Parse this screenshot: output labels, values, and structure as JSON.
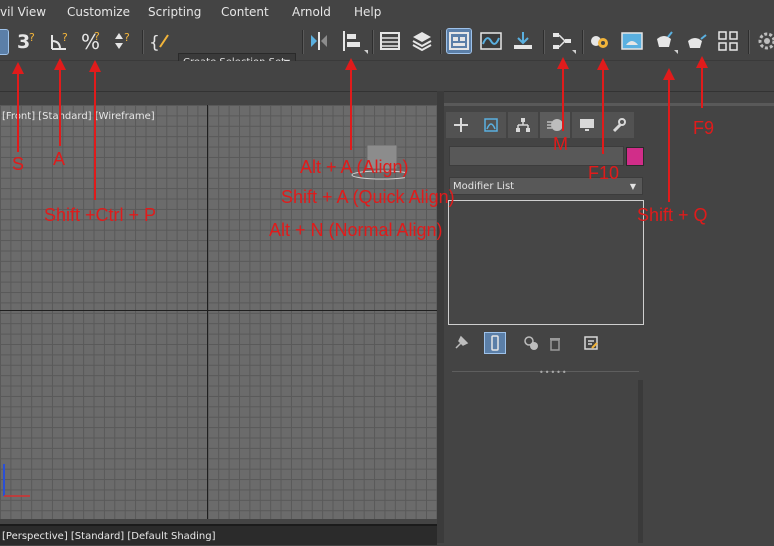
{
  "menu": {
    "items": [
      "vil View",
      "Customize",
      "Scripting",
      "Content",
      "Arnold",
      "Help"
    ]
  },
  "toolbar": {
    "selection_set_placeholder": "Create Selection Set"
  },
  "viewports": {
    "front_label": "[Front] [Standard] [Wireframe]",
    "perspective_label": "[Perspective] [Standard] [Default Shading]"
  },
  "command_panel": {
    "modifier_list_label": "Modifier List",
    "object_color": "#d12d89"
  },
  "annotations": {
    "snap": "S",
    "angle_snap": "A",
    "percent_snap": "Shift +Ctrl + P",
    "align_1": "Alt + A (Align)",
    "align_2": "Shift + A (Quick Align)",
    "align_3": "Alt + N (Normal Align)",
    "material_editor": "M",
    "render_setup": "F10",
    "render": "F9",
    "quick_render": "Shift + Q"
  },
  "colors": {
    "annotation_red": "#e01b1b",
    "active_button": "#5b7fa8",
    "ui_background": "#444444"
  }
}
